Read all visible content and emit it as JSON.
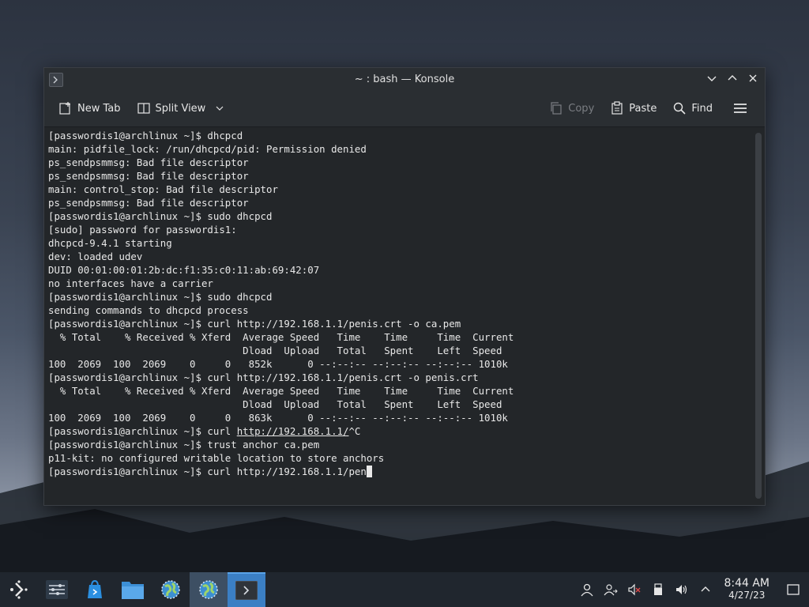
{
  "window": {
    "title": "~ : bash — Konsole"
  },
  "toolbar": {
    "new_tab": "New Tab",
    "split_view": "Split View",
    "copy": "Copy",
    "paste": "Paste",
    "find": "Find"
  },
  "terminal": {
    "lines": [
      "[passwordis1@archlinux ~]$ dhcpcd",
      "main: pidfile_lock: /run/dhcpcd/pid: Permission denied",
      "ps_sendpsmmsg: Bad file descriptor",
      "ps_sendpsmmsg: Bad file descriptor",
      "main: control_stop: Bad file descriptor",
      "ps_sendpsmmsg: Bad file descriptor",
      "[passwordis1@archlinux ~]$ sudo dhcpcd",
      "[sudo] password for passwordis1:",
      "dhcpcd-9.4.1 starting",
      "dev: loaded udev",
      "DUID 00:01:00:01:2b:dc:f1:35:c0:11:ab:69:42:07",
      "no interfaces have a carrier",
      "[passwordis1@archlinux ~]$ sudo dhcpcd",
      "sending commands to dhcpcd process",
      "[passwordis1@archlinux ~]$ curl http://192.168.1.1/penis.crt -o ca.pem",
      "  % Total    % Received % Xferd  Average Speed   Time    Time     Time  Current",
      "                                 Dload  Upload   Total   Spent    Left  Speed",
      "100  2069  100  2069    0     0   852k      0 --:--:-- --:--:-- --:--:-- 1010k",
      "[passwordis1@archlinux ~]$ curl http://192.168.1.1/penis.crt -o penis.crt",
      "  % Total    % Received % Xferd  Average Speed   Time    Time     Time  Current",
      "                                 Dload  Upload   Total   Spent    Left  Speed",
      "100  2069  100  2069    0     0   863k      0 --:--:-- --:--:-- --:--:-- 1010k"
    ],
    "line_link_prefix": "[passwordis1@archlinux ~]$ curl ",
    "line_link_url": "http://192.168.1.1/",
    "line_link_suffix": "^C",
    "trailing_lines": [
      "[passwordis1@archlinux ~]$ trust anchor ca.pem",
      "p11-kit: no configured writable location to store anchors"
    ],
    "current_input": "[passwordis1@archlinux ~]$ curl http://192.168.1.1/pen"
  },
  "taskbar": {
    "apps": [
      {
        "name": "app-launcher-icon"
      },
      {
        "name": "system-settings-icon"
      },
      {
        "name": "discover-store-icon"
      },
      {
        "name": "file-manager-icon"
      },
      {
        "name": "browser-icon"
      },
      {
        "name": "browser-icon"
      },
      {
        "name": "konsole-icon"
      }
    ],
    "time": "8:44 AM",
    "date": "4/27/23"
  },
  "colors": {
    "terminal_bg": "#232629",
    "terminal_fg": "#e8e8e8",
    "taskbar_bg": "#20262e",
    "accent": "#3b7fc4"
  }
}
